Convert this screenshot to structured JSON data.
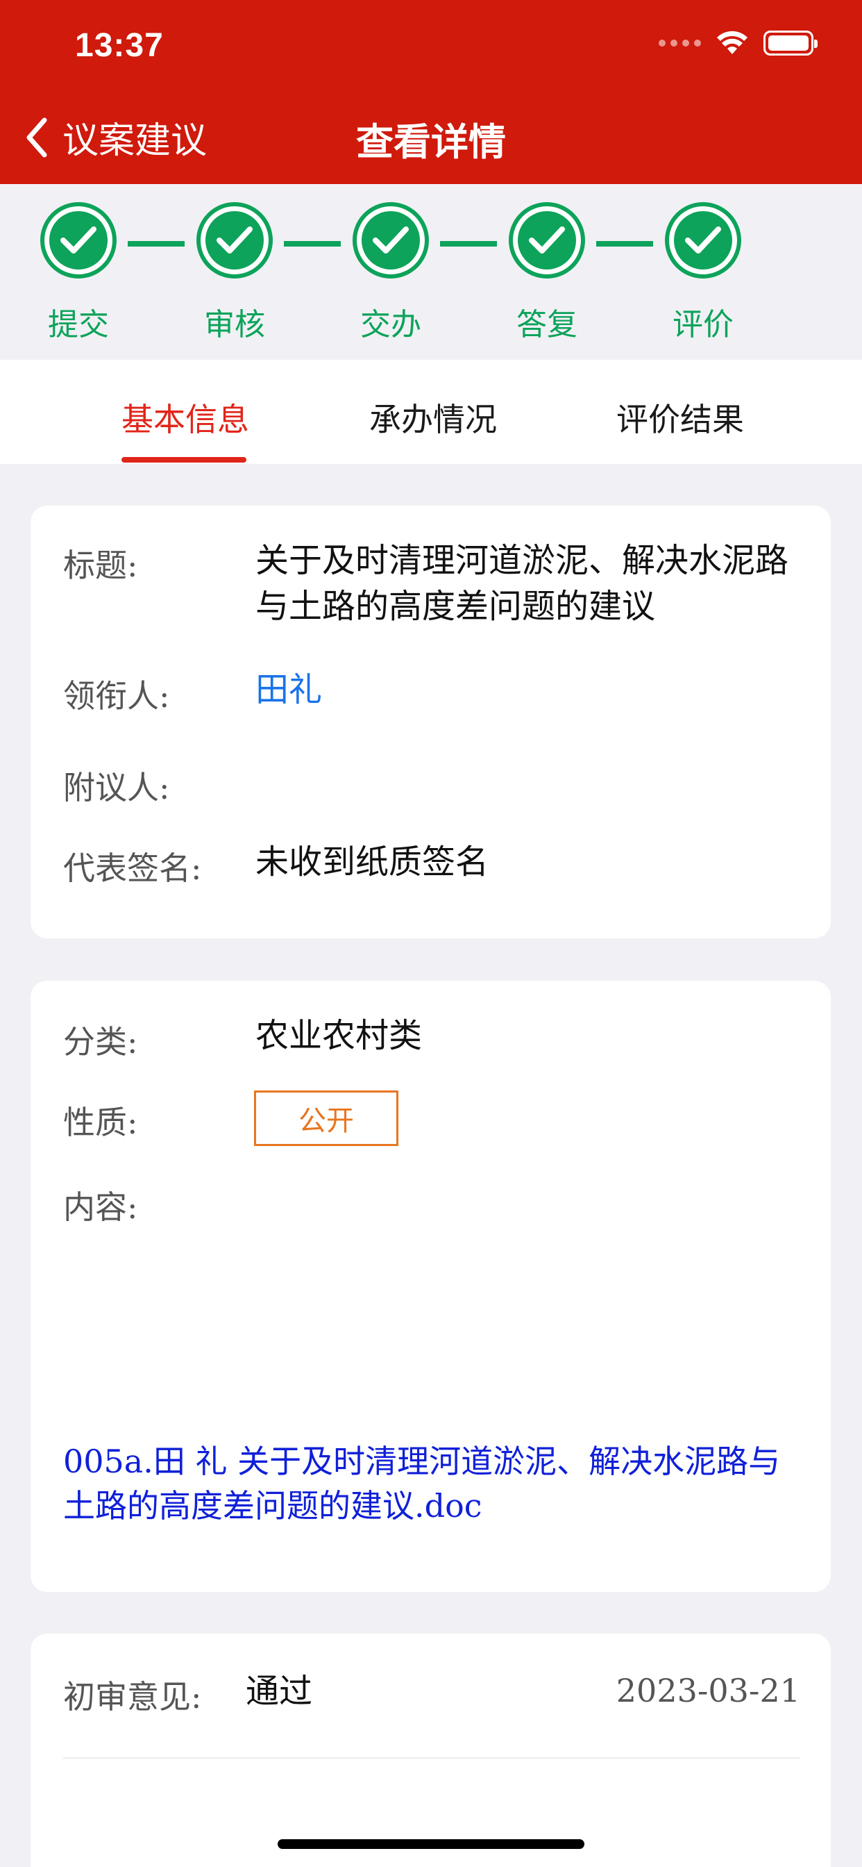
{
  "status_bar": {
    "time": "13:37"
  },
  "nav": {
    "back_label": "议案建议",
    "title": "查看详情"
  },
  "steps": [
    "提交",
    "审核",
    "交办",
    "答复",
    "评价"
  ],
  "tabs": [
    {
      "label": "基本信息",
      "active": true
    },
    {
      "label": "承办情况",
      "active": false
    },
    {
      "label": "评价结果",
      "active": false
    }
  ],
  "basic": {
    "title_label": "标题:",
    "title_value": "关于及时清理河道淤泥、解决水泥路与土路的高度差问题的建议",
    "leader_label": "领衔人:",
    "leader_value": "田礼",
    "cosigner_label": "附议人:",
    "cosigner_value": "",
    "signature_label": "代表签名:",
    "signature_value": "未收到纸质签名"
  },
  "detail": {
    "category_label": "分类:",
    "category_value": "农业农村类",
    "nature_label": "性质:",
    "nature_value": "公开",
    "content_label": "内容:",
    "attachment": "005a.田  礼  关于及时清理河道淤泥、解决水泥路与土路的高度差问题的建议.doc"
  },
  "review": {
    "label": "初审意见:",
    "value": "通过",
    "date": "2023-03-21"
  },
  "colors": {
    "header_red": "#cf1a0c",
    "step_green": "#0da35a",
    "tab_active_red": "#e0251b",
    "link_blue": "#1a73e8",
    "attachment_blue": "#1020d8",
    "badge_orange": "#e8761f"
  }
}
